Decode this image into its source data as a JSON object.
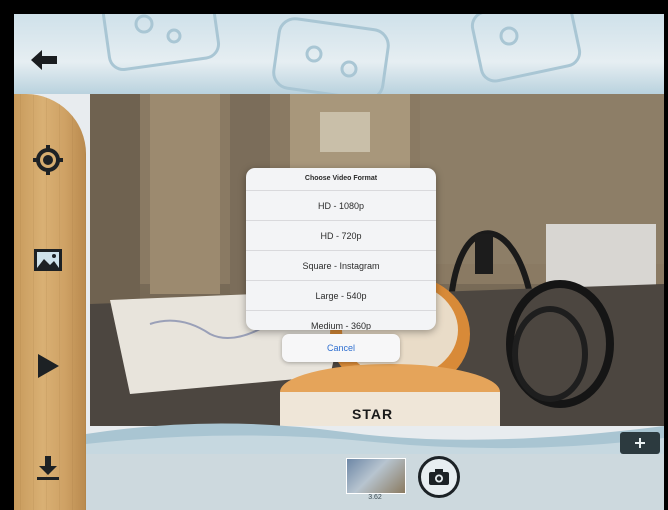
{
  "toolbar": {
    "back_icon": "back-arrow-icon",
    "settings_icon": "gear-icon",
    "background_icon": "landscape-image-icon",
    "play_icon": "play-icon",
    "download_icon": "download-icon"
  },
  "dialog": {
    "title": "Choose Video Format",
    "options": [
      {
        "label": "HD - 1080p"
      },
      {
        "label": "HD - 720p"
      },
      {
        "label": "Square - Instagram"
      },
      {
        "label": "Large - 540p"
      },
      {
        "label": "Medium - 360p"
      }
    ],
    "cancel_label": "Cancel"
  },
  "preview": {
    "toy_logo_text": "STAR"
  },
  "bottom": {
    "thumbnail_caption": "3.62",
    "shutter_icon": "camera-icon",
    "add_icon": "plus-icon"
  },
  "colors": {
    "wood": "#d2a86c",
    "dialog_bg": "#f3f4f6",
    "cancel_text": "#2f6fd0",
    "header_bg": "#cfe1ea"
  }
}
